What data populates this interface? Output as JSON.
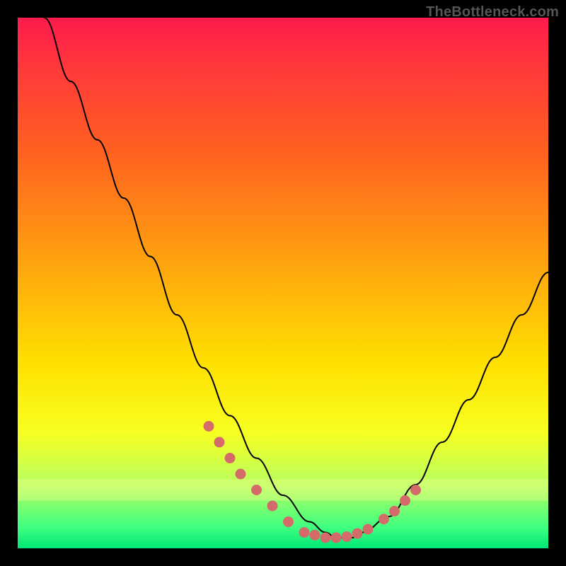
{
  "watermark": "TheBottleneck.com",
  "colors": {
    "page_bg": "#000000",
    "gradient_top": "#ff1a4d",
    "gradient_bottom": "#00e676",
    "curve": "#000000",
    "dots": "#d46a6a",
    "haze_band": "#f5ff90"
  },
  "chart_data": {
    "type": "line",
    "title": "",
    "xlabel": "",
    "ylabel": "",
    "xlim": [
      0,
      100
    ],
    "ylim": [
      0,
      100
    ],
    "grid": false,
    "legend": false,
    "annotations": [],
    "series": [
      {
        "name": "curve",
        "x": [
          5,
          10,
          15,
          20,
          25,
          30,
          35,
          40,
          45,
          50,
          55,
          58,
          60,
          63,
          65,
          70,
          75,
          80,
          85,
          90,
          95,
          100
        ],
        "y": [
          100,
          88,
          77,
          66,
          55,
          44,
          34,
          25,
          17,
          10,
          5,
          3,
          2,
          2,
          3,
          6,
          12,
          20,
          28,
          36,
          44,
          52
        ]
      }
    ],
    "highlight_points": {
      "name": "dots",
      "x": [
        36,
        38,
        40,
        42,
        45,
        48,
        51,
        54,
        56,
        58,
        60,
        62,
        64,
        66,
        69,
        71,
        73,
        75
      ],
      "y": [
        23,
        20,
        17,
        14,
        11,
        8,
        5,
        3,
        2.5,
        2,
        2,
        2.2,
        2.8,
        3.6,
        5.5,
        7,
        9,
        11
      ]
    },
    "haze_band_y": [
      9,
      13
    ]
  }
}
